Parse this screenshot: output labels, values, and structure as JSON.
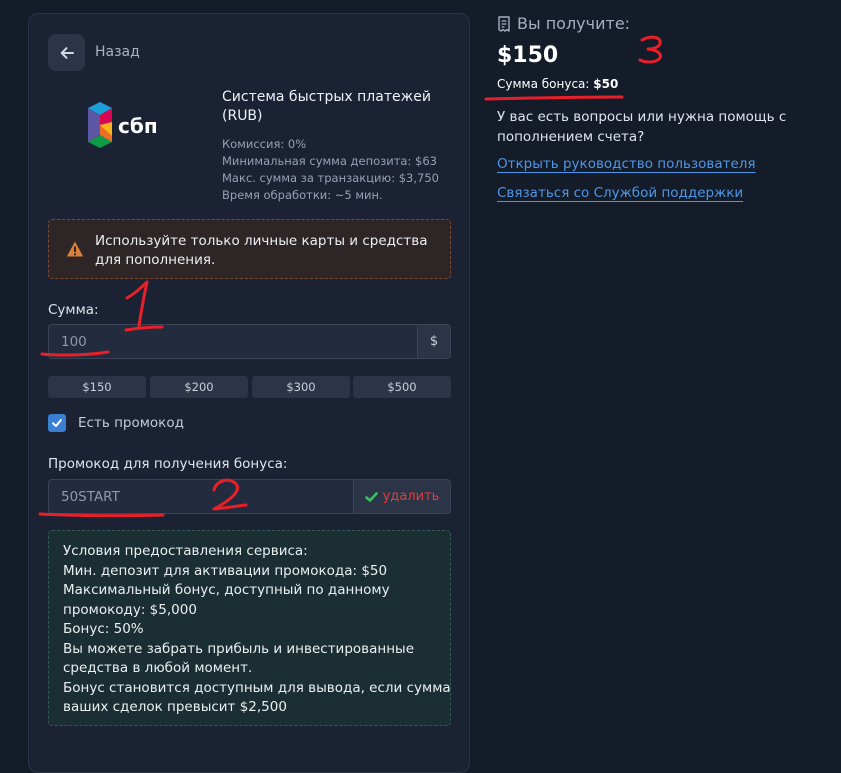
{
  "back": {
    "label": "Назад"
  },
  "payment_method": {
    "logo_text": "сбп",
    "title": "Система быстрых платежей (RUB)",
    "info": [
      "Комиссия: 0%",
      "Минимальная сумма депозита: $63",
      "Макс. сумма за транзакцию: $3,750",
      "Время обработки: ~5 мин."
    ]
  },
  "warning": {
    "text": "Используйте только личные карты и средства для пополнения."
  },
  "amount": {
    "label": "Сумма:",
    "value": "100",
    "currency": "$",
    "presets": [
      "$150",
      "$200",
      "$300",
      "$500"
    ]
  },
  "promo_toggle": {
    "label": "Есть промокод",
    "checked": true
  },
  "promo": {
    "label": "Промокод для получения бонуса:",
    "value": "50START",
    "delete_label": "удалить"
  },
  "terms": {
    "lines": [
      "Условия предоставления сервиса:",
      "Мин. депозит для активации промокода: $50",
      "Максимальный бонус, доступный по данному",
      "промокоду: $5,000",
      "Бонус: 50%",
      "Вы можете забрать прибыль и инвестированные",
      "средства в любой момент.",
      "Бонус становится доступным для вывода, если сумма",
      "ваших сделок превысит $2,500"
    ]
  },
  "summary": {
    "header": "Вы получите:",
    "amount": "$150",
    "bonus_label": "Сумма бонуса:",
    "bonus_value": "$50",
    "question": "У вас есть вопросы или нужна помощь с пополнением счета?",
    "link_guide": "Открыть руководство пользователя",
    "link_support": "Связаться со Службой поддержки"
  },
  "annotations": {
    "mark1": "1",
    "mark2": "2",
    "mark3": "3"
  },
  "colors": {
    "background": "#141b29",
    "panel": "#1a2233",
    "accent": "#3b7fd0",
    "link": "#4e97e6",
    "danger": "#e23b3b",
    "success": "#3fbf6a",
    "warning": "#d9803a",
    "annotation": "#e8202a"
  }
}
